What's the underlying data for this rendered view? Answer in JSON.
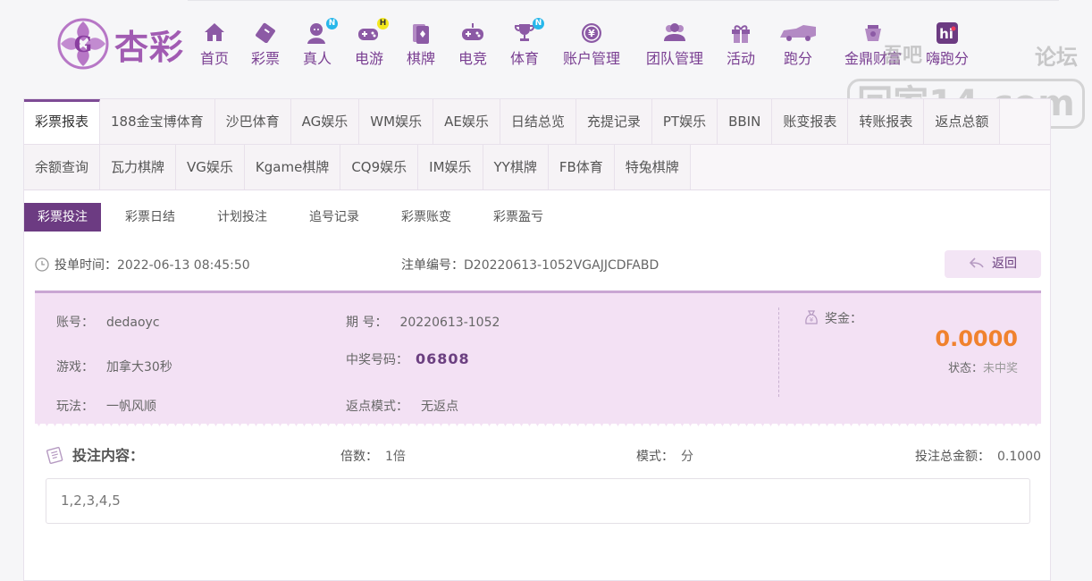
{
  "brand": {
    "name": "杏彩",
    "color": "#a15bb2"
  },
  "nav": [
    {
      "label": "首页",
      "icon": "home-icon"
    },
    {
      "label": "彩票",
      "icon": "lottery-ticket-icon"
    },
    {
      "label": "真人",
      "icon": "live-dealer-icon",
      "badge": "N"
    },
    {
      "label": "电游",
      "icon": "gamepad-icon",
      "badge": "H"
    },
    {
      "label": "棋牌",
      "icon": "cards-icon"
    },
    {
      "label": "电竞",
      "icon": "esports-controller-icon"
    },
    {
      "label": "体育",
      "icon": "trophy-icon",
      "badge": "N"
    },
    {
      "label": "账户管理",
      "icon": "account-coin-icon"
    },
    {
      "label": "团队管理",
      "icon": "team-icon"
    },
    {
      "label": "活动",
      "icon": "gift-icon"
    },
    {
      "label": "跑分",
      "icon": "car-icon"
    },
    {
      "label": "金鼎财富",
      "icon": "treasure-icon"
    },
    {
      "label": "嗨跑分",
      "icon": "hi-icon"
    }
  ],
  "watermark": {
    "line1": "吾吧",
    "line2": "论坛",
    "box": "回家14.com"
  },
  "subnav": {
    "row1": [
      "彩票报表",
      "188金宝博体育",
      "沙巴体育",
      "AG娱乐",
      "WM娱乐",
      "AE娱乐",
      "日结总览",
      "充提记录",
      "PT娱乐",
      "BBIN",
      "账变报表",
      "转账报表",
      "返点总额"
    ],
    "row2": [
      "余额查询",
      "瓦力棋牌",
      "VG娱乐",
      "Kgame棋牌",
      "CQ9娱乐",
      "IM娱乐",
      "YY棋牌",
      "FB体育",
      "特兔棋牌"
    ],
    "active": "彩票报表"
  },
  "tabs": [
    "彩票投注",
    "彩票日结",
    "计划投注",
    "追号记录",
    "彩票账变",
    "彩票盈亏"
  ],
  "order": {
    "time_label": "投单时间：",
    "time": "2022-06-13 08:45:50",
    "id_label": "注单编号：",
    "id": "D20220613-1052VGAJJCDFABD",
    "back_label": "返回"
  },
  "ticket": {
    "account_label": "账号：",
    "account": "dedaoyc",
    "game_label": "游戏：",
    "game": "加拿大30秒",
    "play_label": "玩法：",
    "play": "一帆风顺",
    "period_label": "期 号：",
    "period": "20220613-1052",
    "win_number_label": "中奖号码：",
    "win_number": "06808",
    "rebate_label": "返点模式：",
    "rebate": "无返点",
    "prize_label": "奖金：",
    "prize": "0.0000",
    "status_label": "状态：",
    "status": "未中奖",
    "prize_color": "#f0822e"
  },
  "bet": {
    "title": "投注内容：",
    "multiple_label": "倍数：",
    "multiple": "1倍",
    "mode_label": "模式：",
    "mode": "分",
    "total_label": "投注总金额：",
    "total": "0.1000",
    "content": "1,2,3,4,5"
  },
  "theme": {
    "accent": "#6c3b82",
    "card_bg": "#f3e1f4"
  }
}
